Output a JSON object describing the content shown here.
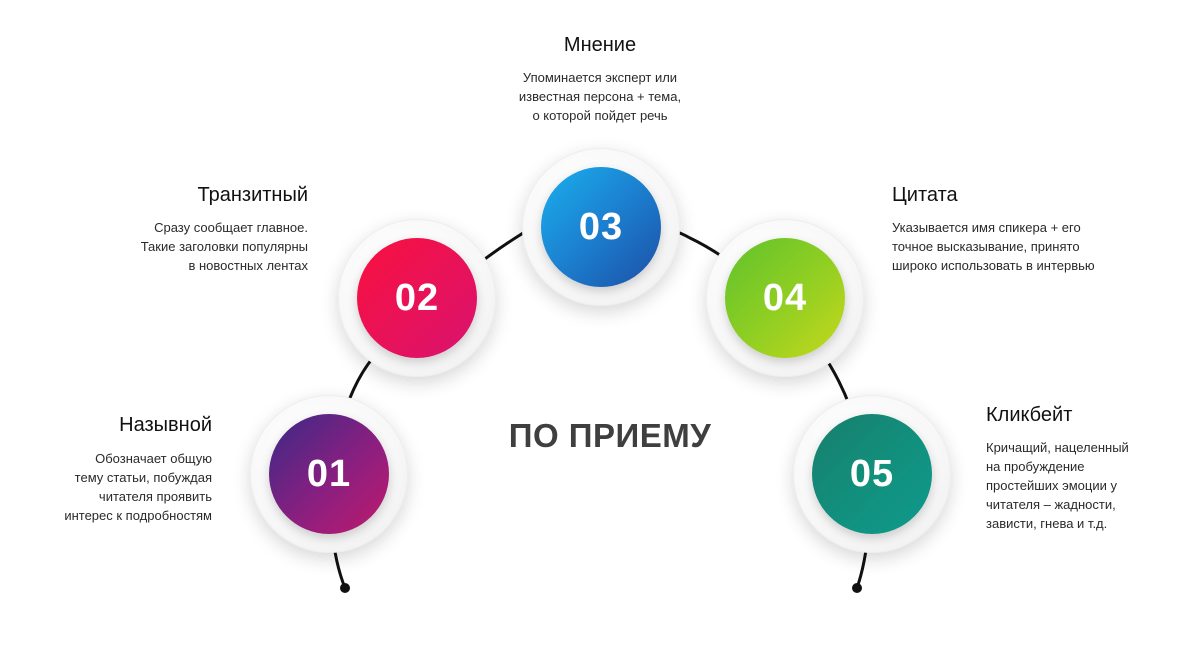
{
  "center_label": "ПО ПРИЕМУ",
  "items": [
    {
      "number": "01",
      "title": "Назывной",
      "description": [
        "Обозначает общую",
        "тему статьи, побуждая",
        "читателя проявить",
        "интерес к подробностям"
      ],
      "colors": [
        "#3a2a86",
        "#c01a6b"
      ]
    },
    {
      "number": "02",
      "title": "Транзитный",
      "description": [
        "Сразу сообщает главное.",
        "Такие заголовки популярны",
        "в новостных лентах"
      ],
      "colors": [
        "#f2104a",
        "#d8136e"
      ]
    },
    {
      "number": "03",
      "title": "Мнение",
      "description": [
        "Упоминается эксперт или",
        "известная персона + тема,",
        "о которой пойдет речь"
      ],
      "colors": [
        "#1aa3e8",
        "#1d4fa5"
      ]
    },
    {
      "number": "04",
      "title": "Цитата",
      "description": [
        "Указывается имя спикера + его",
        "точное высказывание, принято",
        "широко использовать в интервью"
      ],
      "colors": [
        "#6cc62a",
        "#c7d81c"
      ]
    },
    {
      "number": "05",
      "title": "Кликбейт",
      "description": [
        "Кричащий, нацеленный",
        "на пробуждение",
        "простейших эмоции у",
        "читателя – жадности,",
        "зависти, гнева и т.д."
      ],
      "colors": [
        "#128a74",
        "#0f9a8c"
      ]
    }
  ]
}
